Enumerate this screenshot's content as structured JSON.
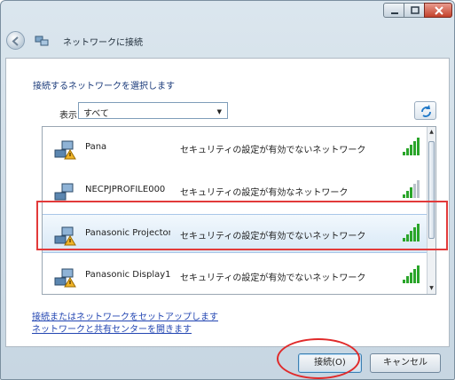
{
  "window": {
    "title": "ネットワークに接続",
    "controls": {
      "minimize": "minimize",
      "maximize": "maximize",
      "close": "close"
    }
  },
  "content": {
    "heading": "接続するネットワークを選択します",
    "show_label": "表示",
    "show_value": "すべて"
  },
  "networks": [
    {
      "name": "Pana",
      "security": "セキュリティの設定が有効でないネットワーク",
      "secured": false,
      "signal_level": 5
    },
    {
      "name": "NECPJPROFILE000",
      "security": "セキュリティの設定が有効なネットワーク",
      "secured": true,
      "signal_level": 3
    },
    {
      "name": "Panasonic Projector...",
      "security": "セキュリティの設定が有効でないネットワーク",
      "secured": false,
      "signal_level": 5,
      "selected": true
    },
    {
      "name": "Panasonic Display1",
      "security": "セキュリティの設定が有効でないネットワーク",
      "secured": false,
      "signal_level": 5
    }
  ],
  "links": {
    "setup": "接続またはネットワークをセットアップします",
    "center": "ネットワークと共有センターを開きます"
  },
  "buttons": {
    "connect": "接続(O)",
    "cancel": "キャンセル"
  },
  "colors": {
    "signal_active": "#2aa52a",
    "signal_inactive": "#b9c2ca",
    "annotation": "#e23a3a",
    "link": "#2346b2"
  }
}
